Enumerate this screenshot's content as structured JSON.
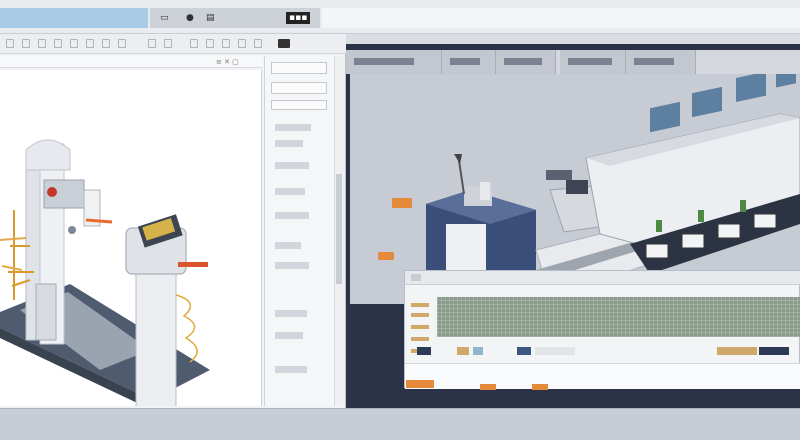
{
  "titlebar": {
    "left_icons": [
      "screen-icon",
      "record-icon",
      "layout-icon",
      "grid-icon"
    ],
    "right_label": "ɪɪɪ"
  },
  "left_window": {
    "toolbar_icons": 16,
    "side_panel": {
      "head_label": "",
      "items": 10
    },
    "model": "3d-lab-instrument"
  },
  "right_window": {
    "tabs": 6,
    "model": "3d-production-line",
    "grid_panel": {
      "timeline_colors": [
        "#2c3a55",
        "#cfa86a",
        "#8fb3c9",
        "#3d5680",
        "#cfa86a",
        "#2c3a55"
      ]
    }
  },
  "colors": {
    "accent": "#a9cbe6",
    "dark_frame": "#2c3348",
    "orange": "#e58a3b",
    "navy": "#3b4e7a"
  }
}
